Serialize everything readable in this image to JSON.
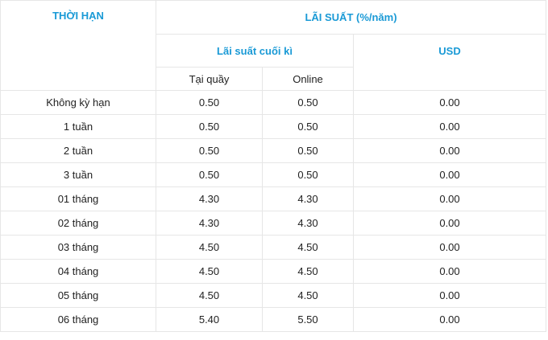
{
  "table": {
    "header": {
      "term": "THỜI HẠN",
      "rate": "LÃI SUẤT (%/năm)",
      "end_of_term": "Lãi suất cuối kì",
      "usd": "USD",
      "counter": "Tại quầy",
      "online": "Online"
    },
    "rows": [
      {
        "term": "Không kỳ hạn",
        "counter": "0.50",
        "online": "0.50",
        "usd": "0.00"
      },
      {
        "term": "1 tuần",
        "counter": "0.50",
        "online": "0.50",
        "usd": "0.00"
      },
      {
        "term": "2 tuần",
        "counter": "0.50",
        "online": "0.50",
        "usd": "0.00"
      },
      {
        "term": "3 tuần",
        "counter": "0.50",
        "online": "0.50",
        "usd": "0.00"
      },
      {
        "term": "01 tháng",
        "counter": "4.30",
        "online": "4.30",
        "usd": "0.00"
      },
      {
        "term": "02 tháng",
        "counter": "4.30",
        "online": "4.30",
        "usd": "0.00"
      },
      {
        "term": "03 tháng",
        "counter": "4.50",
        "online": "4.50",
        "usd": "0.00"
      },
      {
        "term": "04 tháng",
        "counter": "4.50",
        "online": "4.50",
        "usd": "0.00"
      },
      {
        "term": "05 tháng",
        "counter": "4.50",
        "online": "4.50",
        "usd": "0.00"
      },
      {
        "term": "06 tháng",
        "counter": "5.40",
        "online": "5.50",
        "usd": "0.00"
      }
    ]
  }
}
